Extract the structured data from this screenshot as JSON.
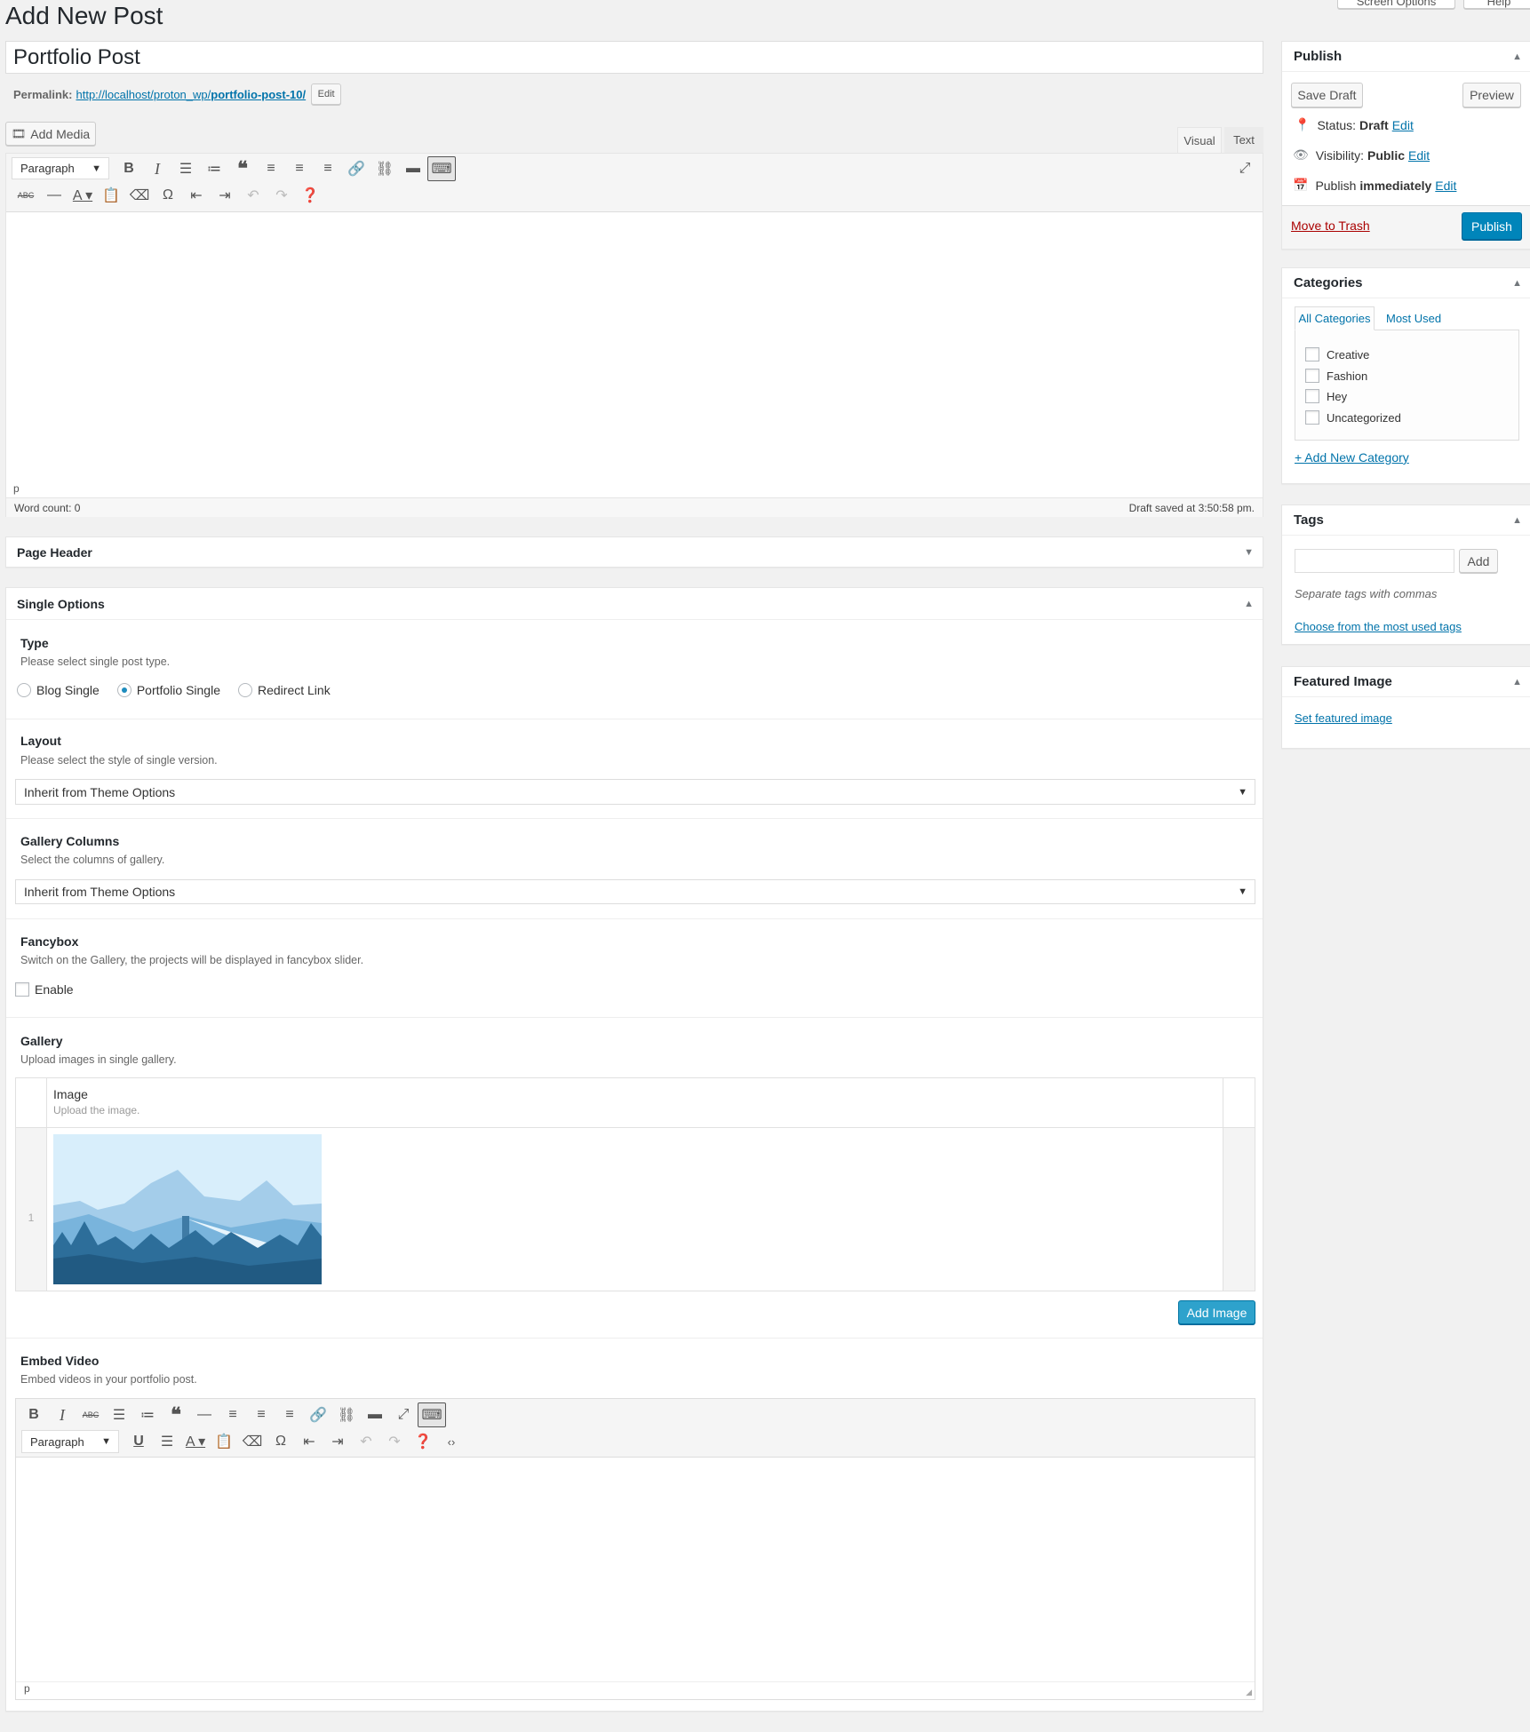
{
  "header": {
    "title": "Add New Post",
    "screen_options": "Screen Options",
    "help": "Help"
  },
  "post": {
    "title": "Portfolio Post",
    "permalink_label": "Permalink:",
    "permalink_base": "http://localhost/proton_wp/",
    "permalink_slug": "portfolio-post-10/",
    "permalink_edit": "Edit"
  },
  "editor": {
    "add_media": "Add Media",
    "tab_visual": "Visual",
    "tab_text": "Text",
    "format": "Paragraph",
    "path": "p",
    "word_count": "Word count: 0",
    "draft_saved": "Draft saved at 3:50:58 pm."
  },
  "page_header": {
    "title": "Page Header"
  },
  "single_options": {
    "title": "Single Options",
    "type": {
      "label": "Type",
      "desc": "Please select single post type.",
      "options": [
        "Blog Single",
        "Portfolio Single",
        "Redirect Link"
      ],
      "selected": "Portfolio Single"
    },
    "layout": {
      "label": "Layout",
      "desc": "Please select the style of single version.",
      "value": "Inherit from Theme Options"
    },
    "gallery_columns": {
      "label": "Gallery Columns",
      "desc": "Select the columns of gallery.",
      "value": "Inherit from Theme Options"
    },
    "fancybox": {
      "label": "Fancybox",
      "desc": "Switch on the Gallery, the projects will be displayed in fancybox slider.",
      "option": "Enable",
      "checked": false
    },
    "gallery": {
      "label": "Gallery",
      "desc": "Upload images in single gallery.",
      "col_title": "Image",
      "col_desc": "Upload the image.",
      "rows": [
        {
          "index": "1"
        }
      ],
      "add_button": "Add Image"
    },
    "embed_video": {
      "label": "Embed Video",
      "desc": "Embed videos in your portfolio post.",
      "format": "Paragraph",
      "path": "p"
    }
  },
  "sidebar": {
    "publish": {
      "title": "Publish",
      "save_draft": "Save Draft",
      "preview": "Preview",
      "status_label": "Status:",
      "status_value": "Draft",
      "visibility_label": "Visibility:",
      "visibility_value": "Public",
      "schedule_label": "Publish",
      "schedule_value": "immediately",
      "edit": "Edit",
      "trash": "Move to Trash",
      "publish_button": "Publish"
    },
    "categories": {
      "title": "Categories",
      "tab_all": "All Categories",
      "tab_most": "Most Used",
      "items": [
        "Creative",
        "Fashion",
        "Hey",
        "Uncategorized"
      ],
      "add_new": "+ Add New Category"
    },
    "tags": {
      "title": "Tags",
      "add": "Add",
      "hint": "Separate tags with commas",
      "choose": "Choose from the most used tags"
    },
    "featured_image": {
      "title": "Featured Image",
      "set": "Set featured image"
    }
  },
  "colors": {
    "accent": "#0085ba",
    "link": "#0073aa",
    "trash": "#a00",
    "background": "#f1f1f1"
  }
}
